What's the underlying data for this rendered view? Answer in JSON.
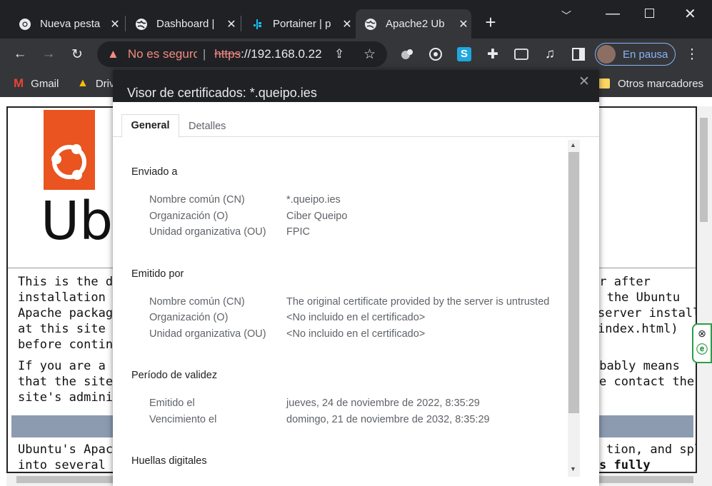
{
  "tabs": [
    {
      "label": "Nueva pesta",
      "icon": "chrome-icon"
    },
    {
      "label": "Dashboard |",
      "icon": "globe-icon"
    },
    {
      "label": "Portainer | p",
      "icon": "portainer-icon"
    },
    {
      "label": "Apache2 Ub",
      "icon": "globe-icon"
    }
  ],
  "toolbar": {
    "security_label": "No es seguro",
    "url_scheme": "https",
    "url_rest": "://192.168.0.22",
    "profile_status": "En pausa"
  },
  "bookmarks": {
    "gmail": "Gmail",
    "drive": "Drive",
    "other": "Otros marcadores"
  },
  "page": {
    "lines": [
      "This is the defa",
      "installation on",
      "Apache packag",
      "at this site is w",
      "before continu",
      "If you are a no",
      "that the site is",
      "site's administ",
      "Ubuntu's Apac",
      "into several file"
    ],
    "right_lines": [
      "er after",
      "th the Ubuntu",
      "server installed",
      "index.html)",
      "obably means",
      "e contact the",
      "tion, and split",
      "s fully"
    ],
    "logo_text": "Ubu"
  },
  "dialog": {
    "title": "Visor de certificados: *.queipo.ies",
    "tabs": [
      "General",
      "Detalles"
    ],
    "sections": {
      "issued_to": {
        "heading": "Enviado a",
        "rows": [
          {
            "k": "Nombre común (CN)",
            "v": "*.queipo.ies"
          },
          {
            "k": "Organización (O)",
            "v": "Ciber Queipo"
          },
          {
            "k": "Unidad organizativa (OU)",
            "v": "FPIC"
          }
        ]
      },
      "issued_by": {
        "heading": "Emitido por",
        "rows": [
          {
            "k": "Nombre común (CN)",
            "v": "The original certificate provided by the server is untrusted"
          },
          {
            "k": "Organización (O)",
            "v": "<No incluido en el certificado>"
          },
          {
            "k": "Unidad organizativa (OU)",
            "v": "<No incluido en el certificado>"
          }
        ]
      },
      "validity": {
        "heading": "Período de validez",
        "rows": [
          {
            "k": "Emitido el",
            "v": "jueves, 24 de noviembre de 2022, 8:35:29"
          },
          {
            "k": "Vencimiento el",
            "v": "domingo, 21 de noviembre de 2032, 8:35:29"
          }
        ]
      },
      "fingerprints": {
        "heading": "Huellas digitales"
      }
    }
  }
}
